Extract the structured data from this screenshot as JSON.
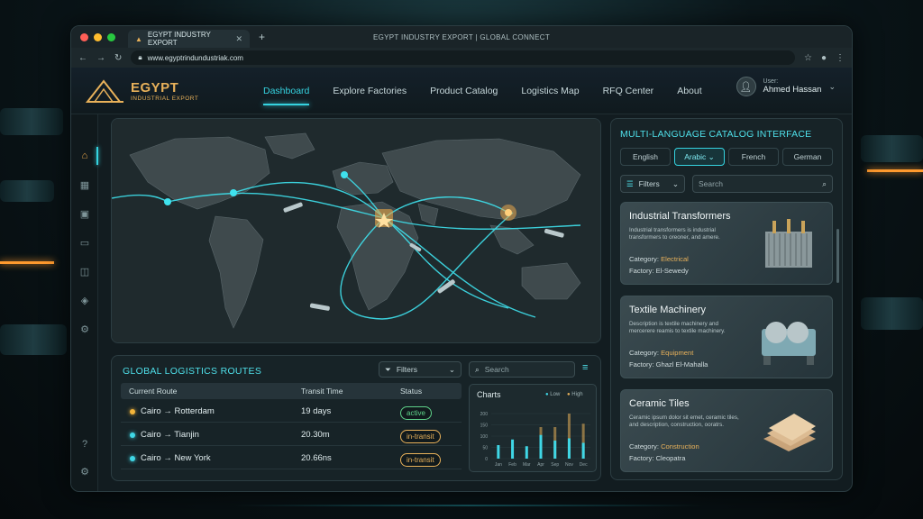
{
  "browser": {
    "tab_title": "EGYPT INDUSTRY EXPORT",
    "window_title": "EGYPT INDUSTRY EXPORT | GLOBAL CONNECT",
    "url": "www.egyptrindundustriak.com"
  },
  "brand": {
    "name": "EGYPT",
    "tagline": "INDUSTRIAL EXPORT"
  },
  "nav": {
    "items": [
      "Dashboard",
      "Explore Factories",
      "Product Catalog",
      "Logistics Map",
      "RFQ Center",
      "About"
    ],
    "active": "Dashboard"
  },
  "user": {
    "label": "User:",
    "name": "Ahmed Hassan"
  },
  "logistics": {
    "title": "GLOBAL LOGISTICS ROUTES",
    "filters_label": "Filters",
    "search_placeholder": "Search",
    "columns": [
      "Current Route",
      "Transit Time",
      "Status"
    ],
    "rows": [
      {
        "route": "Cairo → Rotterdam",
        "time": "19 days",
        "status": "active",
        "dot": "#f2b43a"
      },
      {
        "route": "Cairo → Tianjin",
        "time": "20.30m",
        "status": "in-transit",
        "dot": "#3fd7e6"
      },
      {
        "route": "Cairo → New York",
        "time": "20.66ns",
        "status": "in-transit",
        "dot": "#3fd7e6"
      }
    ]
  },
  "chart_data": {
    "type": "bar",
    "title": "Charts",
    "legend": [
      "Low",
      "High"
    ],
    "categories": [
      "Jan",
      "Feb",
      "Mar",
      "Apr",
      "Sep",
      "Nov",
      "Dec"
    ],
    "series": [
      {
        "name": "Low",
        "values": [
          60,
          85,
          55,
          105,
          80,
          90,
          70
        ]
      },
      {
        "name": "High",
        "values": [
          0,
          0,
          0,
          140,
          140,
          200,
          155
        ]
      }
    ],
    "yticks": [
      200,
      150,
      100,
      50,
      0
    ],
    "ylim": [
      0,
      200
    ]
  },
  "catalog": {
    "title": "MULTI-LANGUAGE CATALOG INTERFACE",
    "languages": [
      "English",
      "Arabic",
      "French",
      "German"
    ],
    "active_language": "Arabic",
    "filters_label": "Filters",
    "search_placeholder": "Search",
    "products": [
      {
        "name": "Industrial Transformers",
        "desc": "Industrial transformers is industrial transformers to oreoner, and amere.",
        "category_label": "Category:",
        "category": "Electrical",
        "factory_label": "Factory:",
        "factory": "El-Sewedy"
      },
      {
        "name": "Textile Machinery",
        "desc": "Description is textile machinery and mercerere reamis to textile machinery.",
        "category_label": "Category:",
        "category": "Equipment",
        "factory_label": "Factory:",
        "factory": "Ghazl El-Mahalla"
      },
      {
        "name": "Ceramic Tiles",
        "desc": "Ceramic ipsum dolor sit emet, ceramic tiles, and description, construction, ooratrs.",
        "category_label": "Category:",
        "category": "Construction",
        "factory_label": "Factory:",
        "factory": "Cleopatra"
      }
    ]
  },
  "colors": {
    "accent": "#35d3e0",
    "gold": "#e8b15a",
    "active_green": "#5fd38a",
    "transit_amber": "#e8b15a"
  }
}
